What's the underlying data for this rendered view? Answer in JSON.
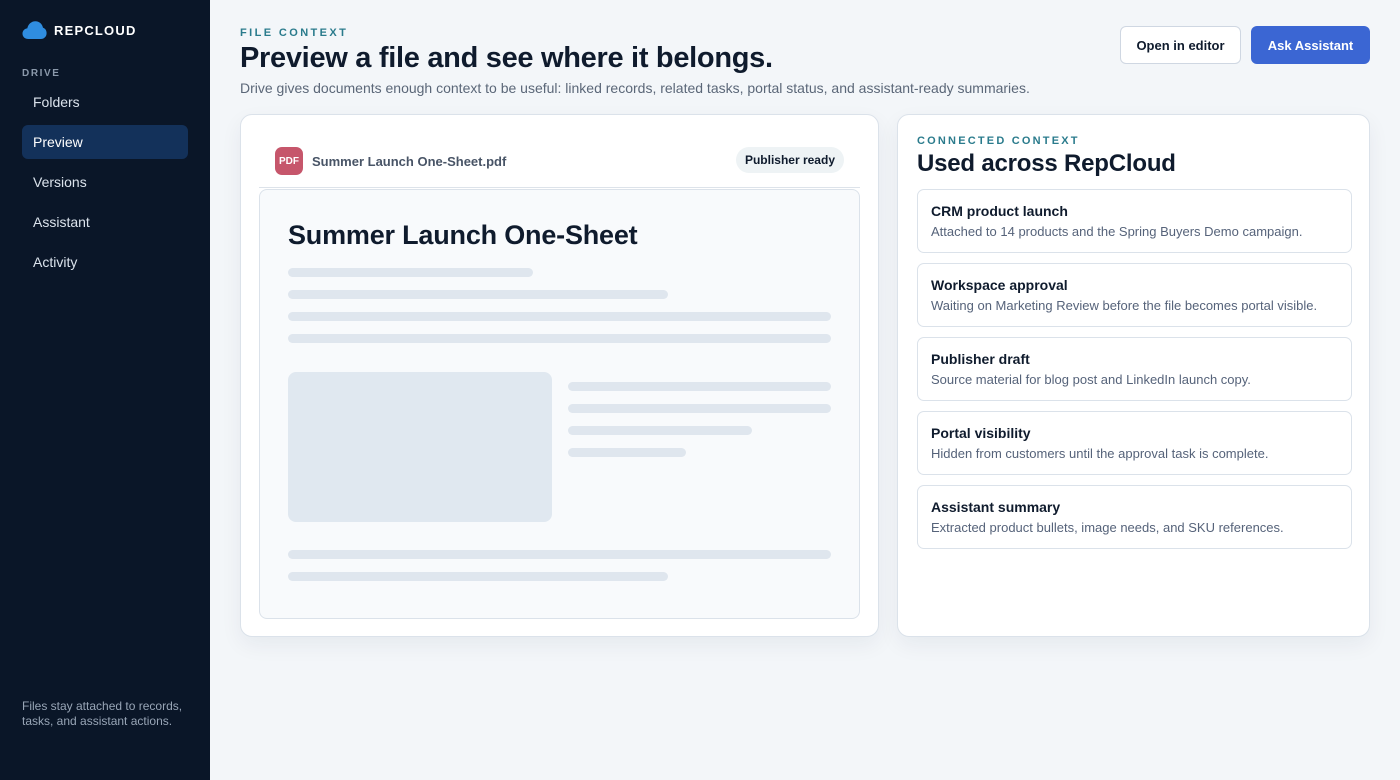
{
  "sidebar": {
    "brand": "REPCLOUD",
    "section": "DRIVE",
    "items": [
      {
        "label": "Folders"
      },
      {
        "label": "Preview"
      },
      {
        "label": "Versions"
      },
      {
        "label": "Assistant"
      },
      {
        "label": "Activity"
      }
    ],
    "active_index": 1,
    "footer": "Files stay attached to records, tasks, and assistant actions."
  },
  "header": {
    "eyebrow": "FILE CONTEXT",
    "title": "Preview a file and see where it belongs.",
    "subtitle": "Drive gives documents enough context to be useful: linked records, related tasks, portal status, and assistant-ready summaries.",
    "open_editor_label": "Open in editor",
    "ask_assistant_label": "Ask Assistant"
  },
  "preview": {
    "file_icon": "PDF",
    "file_name": "Summer Launch One-Sheet.pdf",
    "status_badge": "Publisher ready",
    "doc_title": "Summer Launch One-Sheet"
  },
  "context": {
    "eyebrow": "CONNECTED CONTEXT",
    "title": "Used across RepCloud",
    "items": [
      {
        "title": "CRM product launch",
        "desc": "Attached to 14 products and the Spring Buyers Demo campaign."
      },
      {
        "title": "Workspace approval",
        "desc": "Waiting on Marketing Review before the file becomes portal visible."
      },
      {
        "title": "Publisher draft",
        "desc": "Source material for blog post and LinkedIn launch copy."
      },
      {
        "title": "Portal visibility",
        "desc": "Hidden from customers until the approval task is complete."
      },
      {
        "title": "Assistant summary",
        "desc": "Extracted product bullets, image needs, and SKU references."
      }
    ]
  },
  "colors": {
    "sidebar_bg": "#0a1628",
    "accent": "#3b66d3",
    "eyebrow": "#2a7b8c",
    "pdf_icon": "#c6566b"
  },
  "icons": {
    "brand": "cloud-icon"
  }
}
